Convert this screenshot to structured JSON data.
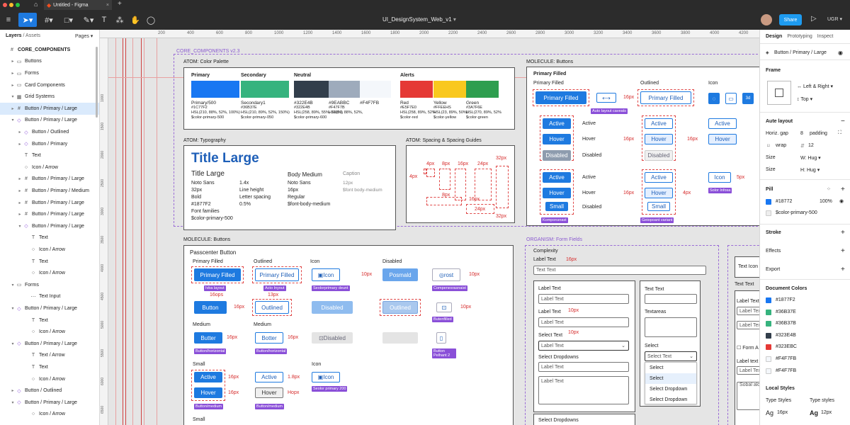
{
  "app": {
    "tab_title": "Untitled - Figma",
    "file_title": "UI_DesignSystem_Web_v1",
    "share_label": "Share",
    "user_label": "UGR",
    "accent": "#1e7ae0"
  },
  "ruler": {
    "ticks": [
      "200",
      "400",
      "600",
      "800",
      "1000",
      "1200",
      "1400",
      "1600",
      "1800",
      "2000",
      "2200",
      "2400",
      "2600",
      "2800",
      "3000",
      "3200",
      "3400",
      "3600",
      "3800",
      "4000",
      "4200"
    ],
    "vticks": [
      "1000",
      "1500",
      "2000",
      "2500",
      "3000",
      "3500",
      "4000",
      "4500",
      "5000",
      "5500",
      "6000",
      "6500"
    ]
  },
  "left": {
    "layers_tab": "Layers",
    "assets_tab": "/ Assets",
    "pages_label": "Pages",
    "items": [
      {
        "label": "CORE_COMPONENTS",
        "icon": "#",
        "caret": "",
        "indent": 0
      },
      {
        "label": "Buttons",
        "icon": "▭",
        "caret": "▸",
        "indent": 1
      },
      {
        "label": "Forms",
        "icon": "▭",
        "caret": "▸",
        "indent": 1
      },
      {
        "label": "Card Components",
        "icon": "▭",
        "caret": "▸",
        "indent": 1
      },
      {
        "label": "Grid Systems",
        "icon": "▦",
        "caret": "▾",
        "indent": 1
      },
      {
        "label": "Button / Primary / Large",
        "icon": "#",
        "caret": "▸",
        "indent": 1,
        "selected": true
      },
      {
        "label": "Button / Primary / Large",
        "icon": "◇",
        "caret": "▾",
        "indent": 1
      },
      {
        "label": "Button / Outlined",
        "icon": "◇",
        "caret": "▸",
        "indent": 2
      },
      {
        "label": "Button / Primary",
        "icon": "◇",
        "caret": "▸",
        "indent": 2
      },
      {
        "label": "Text",
        "icon": "T",
        "caret": "",
        "indent": 2
      },
      {
        "label": "Icon / Arrow",
        "icon": "○",
        "caret": "",
        "indent": 2
      },
      {
        "label": "Button / Primary / Large",
        "icon": "#",
        "caret": "▸",
        "indent": 2
      },
      {
        "label": "Button / Primary / Medium",
        "icon": "#",
        "caret": "▸",
        "indent": 2
      },
      {
        "label": "Button / Primary / Large",
        "icon": "#",
        "caret": "▸",
        "indent": 2
      },
      {
        "label": "Button / Primary / Large",
        "icon": "#",
        "caret": "▸",
        "indent": 2
      },
      {
        "label": "Button / Primary / Large",
        "icon": "◇",
        "caret": "▾",
        "indent": 2
      },
      {
        "label": "Text",
        "icon": "T",
        "caret": "",
        "indent": 3
      },
      {
        "label": "Icon / Arrow",
        "icon": "○",
        "caret": "",
        "indent": 3
      },
      {
        "label": "Text",
        "icon": "T",
        "caret": "",
        "indent": 3
      },
      {
        "label": "Icon / Arrow",
        "icon": "○",
        "caret": "",
        "indent": 3
      },
      {
        "label": "Forms",
        "icon": "▭",
        "caret": "▾",
        "indent": 1
      },
      {
        "label": "Text Input",
        "icon": "⋯",
        "caret": "",
        "indent": 3
      },
      {
        "label": "Button / Primary / Large",
        "icon": "◇",
        "caret": "▾",
        "indent": 1
      },
      {
        "label": "Text",
        "icon": "T",
        "caret": "",
        "indent": 3
      },
      {
        "label": "Icon / Arrow",
        "icon": "○",
        "caret": "",
        "indent": 3
      },
      {
        "label": "Button / Primary / Large",
        "icon": "◇",
        "caret": "▾",
        "indent": 1
      },
      {
        "label": "Text / Arrow",
        "icon": "T",
        "caret": "",
        "indent": 3
      },
      {
        "label": "Text",
        "icon": "T",
        "caret": "",
        "indent": 3
      },
      {
        "label": "Icon / Arrow",
        "icon": "○",
        "caret": "",
        "indent": 3
      },
      {
        "label": "Button / Outlined",
        "icon": "◇",
        "caret": "▸",
        "indent": 1
      },
      {
        "label": "Button / Primary / Large",
        "icon": "◇",
        "caret": "▾",
        "indent": 1
      },
      {
        "label": "Icon / Arrow",
        "icon": "○",
        "caret": "",
        "indent": 3
      }
    ]
  },
  "canvas": {
    "core_title": "CORE_COMPONENTS v2.3",
    "palette": {
      "title": "ATOM: Color Palette",
      "primary": "Primary",
      "secondary": "Secondary",
      "neutral": "Neutral",
      "alerts": "Alerts",
      "colors": [
        {
          "name": "Primary/500",
          "hex": "#1C77F2",
          "extra": "HSL(210, 88%, 52%, 100%)",
          "token": "$color-primary-500",
          "color": "#1877F2"
        },
        {
          "name": "Secondary1",
          "hex": "#36B37E",
          "extra": "HSL(210, 89%, 52%, 150%)",
          "token": "$color-primary-050",
          "color": "#36B37E"
        },
        {
          "name": "#322E4B",
          "hex": "#322E4B",
          "extra": "HSL(258, 89%, 55%, 100%)",
          "token": "$color-primary-600",
          "color": "#323E4B"
        },
        {
          "name": "#9EABBC",
          "hex": "#F47F7B",
          "extra": "HSL(93, 88%, 52%, 10%)",
          "token": "",
          "color": "#9EABBC"
        },
        {
          "name": "#F4F7FB",
          "hex": "",
          "extra": "",
          "token": "",
          "color": "#F4F7FB"
        },
        {
          "name": "Red",
          "hex": "#E5F7E0",
          "extra": "HSL(258, 89%, 52%)",
          "token": "$color-red",
          "color": "#E53935"
        },
        {
          "name": "Yellow",
          "hex": "#FFEEHS",
          "extra": "HSL(23, 89%, 50%)",
          "token": "$color-yellow",
          "color": "#F9C81E"
        },
        {
          "name": "Green",
          "hex": "#3A7F6E",
          "extra": "HSL(270, 89%, 52%, 100%)",
          "token": "$color-green",
          "color": "#2E9E4F"
        }
      ]
    },
    "typography": {
      "title": "ATOM: Typography",
      "big": "Title Large",
      "sub": "Title Large",
      "c1": [
        "Noto Sans",
        "32px",
        "Bold",
        "#1877F2",
        "Font families",
        "$color-primary-500"
      ],
      "c2": [
        "1.4x",
        "Line height",
        "Letter spacing",
        "0.5%"
      ],
      "body": "Body Medium",
      "c3": [
        "Noto Sans",
        "16px",
        "Regular",
        "$font-body-medium"
      ],
      "caption": "Caption",
      "c4": [
        "12px",
        "$font body-medium"
      ]
    },
    "spacing": {
      "title": "ATOM: Spacing & Spacing Guides",
      "labels": [
        "4px",
        "4px",
        "8px",
        "8px",
        "16px",
        "24px",
        "32px",
        "16px",
        "24px",
        "32px"
      ]
    },
    "molecule_right": {
      "title": "MOLECULE: Buttons",
      "primary_filled": "Primary Filled",
      "outlined": "Outlined",
      "icon": "Icon",
      "btn_primary": "Primary Filled",
      "btn_outlined": "Primary Filled",
      "tag1": "Auto layout caveats",
      "states": [
        "Active",
        "Hover",
        "Disabled"
      ],
      "states2": [
        "Active",
        "Hover",
        "Small"
      ],
      "state_labels": [
        "Active",
        "Hover",
        "Disabled"
      ],
      "state_labels2": [
        "Active",
        "Hover",
        "Disabled"
      ],
      "out_states": [
        "Active",
        "Hover",
        "Disabled"
      ],
      "out_states2": [
        "Active",
        "Hover",
        "Small"
      ],
      "ic_states": [
        "Active",
        "Hover"
      ],
      "ic2": "Icon",
      "px16": "16px",
      "px4": "4px",
      "px5": "5px",
      "tag2": "Komponsnast",
      "tag3": "Geiopoant variant",
      "tag4": "Solor Infosa"
    },
    "molecule_left": {
      "title": "MOLECULE: Buttons",
      "sub": "Passcenter Button",
      "primary_filled": "Primary Filled",
      "outlined": "Outlined",
      "icon": "Icon",
      "disabled": "Disabled",
      "b1": "Primary Filled",
      "b2": "Primary Filled",
      "b3": "Icon",
      "b4": "Posmald",
      "b5": "rost",
      "tags": [
        "Ivba layout",
        "Acto Inyout",
        "Seolorprimary deunt",
        "Compenesrasnaist"
      ],
      "sp": [
        "16ops",
        "13px",
        "10px",
        "10px"
      ],
      "row2": [
        "Button",
        "Outlined",
        "Disabled",
        "Outlined"
      ],
      "px16": "16px",
      "px10": "10px",
      "tag5": "Butenfilled",
      "medium": "Medium",
      "medium2": "Medium",
      "row3": [
        "Butter",
        "Botter",
        "Disabled"
      ],
      "tags3": [
        "Button/horizontal",
        "Button/horizontal",
        "Button Pelhant 2"
      ],
      "small": "Small",
      "row4": [
        "Active",
        "Active",
        "Icon"
      ],
      "row5": [
        "Hover",
        "Hover"
      ],
      "px18": "1.8px",
      "hopx": "Hopx",
      "tags4": [
        "Button/medium",
        "Button/medium",
        "Seolor primary 200"
      ],
      "small2": "Small"
    },
    "organism": {
      "title": "ORGANISM: Form Fields",
      "complexity": "Complexity",
      "label_text": "Label Text",
      "text_text": "Text Text",
      "px16": "16px",
      "px10": "10px",
      "labels": [
        "Label Text",
        "Label Text",
        "Select Text",
        "Select Dropdowns"
      ],
      "inputs": [
        "Label Text",
        "Label Text",
        "Label Text",
        "Label Text",
        "Label Text"
      ],
      "select": "Select",
      "textareas": "Textareas",
      "text_text2": "Text Text",
      "select2": "Select",
      "select_text": "Select Text",
      "options": [
        "Select",
        "Select",
        "Select Dropdown",
        "Select Dropdown"
      ],
      "select_dd": "Select Dropdowns",
      "far": [
        "Text Text",
        "Label Text",
        "Label Text",
        "Label Text",
        "Form A",
        "Label text",
        "Label Text",
        "Sobal alo"
      ],
      "text_icon": "Text Icon"
    }
  },
  "right": {
    "tabs": [
      "Design",
      "Prototyping",
      "Inspect"
    ],
    "selection": "Button / Primary / Large",
    "frame": "Frame",
    "align_lr": "Left & Right",
    "align_top": "Top",
    "auto_layout": "Aute layout",
    "horiz_gap": "Horiz. gap",
    "gap_val": "8",
    "padding": "padding",
    "wrap": "wrap",
    "wrap_val": "12",
    "size1": "Size",
    "w_lbl": "W:",
    "w_val": "Hug",
    "size2": "Size",
    "h_lbl": "H:",
    "h_val": "Hug",
    "fill": "Pill",
    "fill_hex": "#18772",
    "fill_pct": "100%",
    "fill_token": "$color-primary-500",
    "stroke": "Stroke",
    "effects": "Effects",
    "export": "Export",
    "doc_colors": "Document Colors",
    "colors": [
      {
        "hex": "#1877F2",
        "label": "#1877F2"
      },
      {
        "hex": "#36B37E",
        "label": "#36B37E"
      },
      {
        "hex": "#36B37E",
        "label": "#36B37B"
      },
      {
        "hex": "#323E4B",
        "label": "#323E4B"
      },
      {
        "hex": "#E53935",
        "label": "#323EBC"
      },
      {
        "hex": "#F4F7FB",
        "label": "#F4F7FB"
      },
      {
        "hex": "#F4F7FB",
        "label": "#F4F7FB"
      }
    ],
    "local_styles": "Local Styles",
    "type_styles": "Type Styles",
    "type_styles2": "Type styles",
    "ts1": "Ag",
    "ts1v": "16px",
    "ts2": "Ag",
    "ts2v": "12px"
  }
}
